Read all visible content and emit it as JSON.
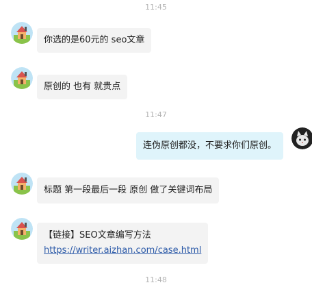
{
  "messages": [
    {
      "type": "time",
      "text": "11:45"
    },
    {
      "type": "msg",
      "side": "left",
      "avatar": "cartoon-house-avatar-icon",
      "text": "你选的是60元的  seo文章"
    },
    {
      "type": "msg",
      "side": "left",
      "avatar": "cartoon-house-avatar-icon",
      "text": "原创的 也有 就贵点"
    },
    {
      "type": "time",
      "text": "11:47"
    },
    {
      "type": "msg",
      "side": "right",
      "avatar": "cat-avatar-icon",
      "text": "连伪原创都没，不要求你们原创。"
    },
    {
      "type": "msg",
      "side": "left",
      "avatar": "cartoon-house-avatar-icon",
      "text": "标题 第一段最后一段 原创   做了关键词布局"
    },
    {
      "type": "msg",
      "side": "left",
      "avatar": "cartoon-house-avatar-icon",
      "line1": "【链接】SEO文章编写方法",
      "link": "https://writer.aizhan.com/case.html"
    },
    {
      "type": "time",
      "text": "11:48"
    }
  ],
  "colors": {
    "left_bubble": "#f3f3f3",
    "right_bubble": "#dff4fb",
    "timestamp": "#b4b4b4",
    "link": "#2c5aa8"
  }
}
